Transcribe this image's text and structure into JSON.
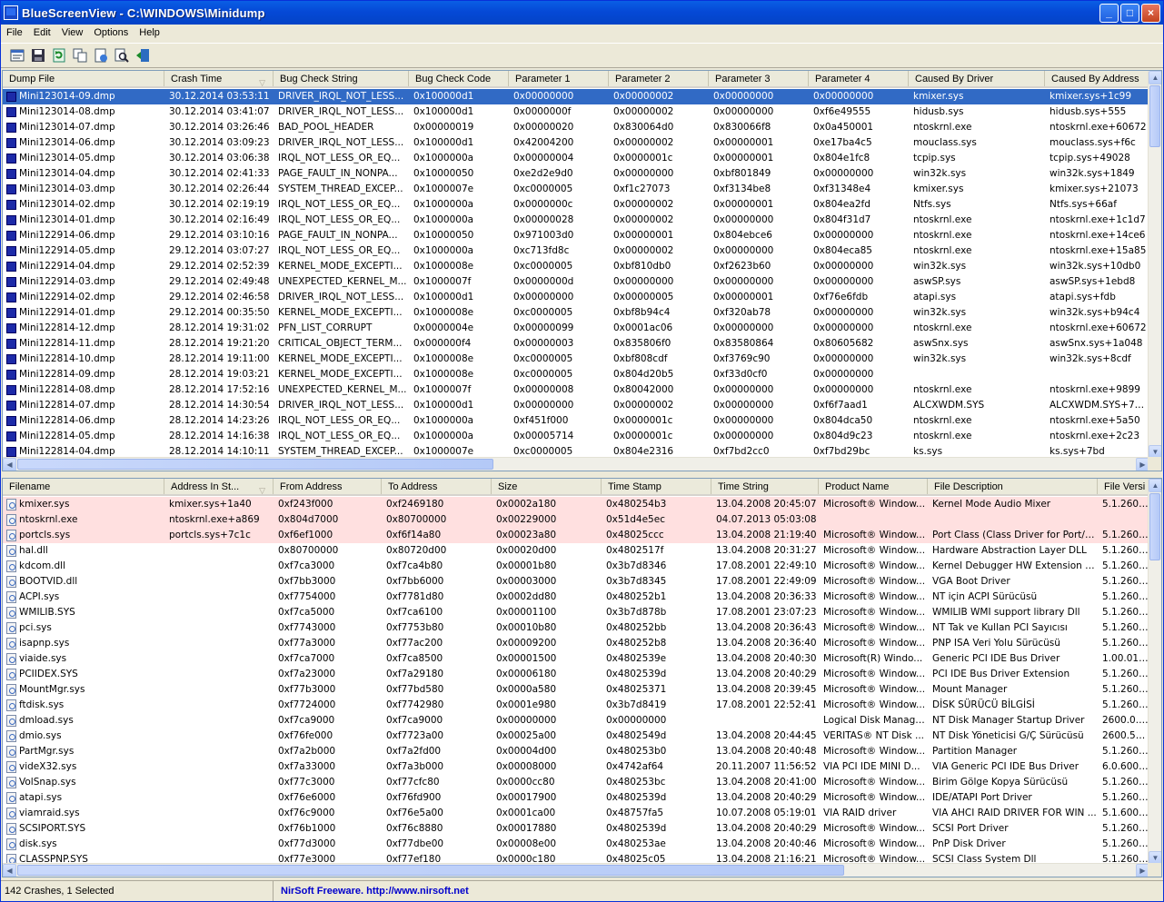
{
  "window": {
    "title": "BlueScreenView  -  C:\\WINDOWS\\Minidump",
    "minimize": "_",
    "maximize": "□",
    "close": "×"
  },
  "menu": [
    "File",
    "Edit",
    "View",
    "Options",
    "Help"
  ],
  "toolbar": [
    "properties-icon",
    "save-icon",
    "refresh-icon",
    "copy-icon",
    "html-report-icon",
    "find-icon",
    "exit-icon"
  ],
  "top_table": {
    "columns": [
      "Dump File",
      "Crash Time",
      "Bug Check String",
      "Bug Check Code",
      "Parameter 1",
      "Parameter 2",
      "Parameter 3",
      "Parameter 4",
      "Caused By Driver",
      "Caused By Address"
    ],
    "rows": [
      [
        "Mini123014-09.dmp",
        "30.12.2014 03:53:11",
        "DRIVER_IRQL_NOT_LESS...",
        "0x100000d1",
        "0x00000000",
        "0x00000002",
        "0x00000000",
        "0x00000000",
        "kmixer.sys",
        "kmixer.sys+1c99"
      ],
      [
        "Mini123014-08.dmp",
        "30.12.2014 03:41:07",
        "DRIVER_IRQL_NOT_LESS...",
        "0x100000d1",
        "0x0000000f",
        "0x00000002",
        "0x00000000",
        "0xf6e49555",
        "hidusb.sys",
        "hidusb.sys+555"
      ],
      [
        "Mini123014-07.dmp",
        "30.12.2014 03:26:46",
        "BAD_POOL_HEADER",
        "0x00000019",
        "0x00000020",
        "0x830064d0",
        "0x830066f8",
        "0x0a450001",
        "ntoskrnl.exe",
        "ntoskrnl.exe+60672"
      ],
      [
        "Mini123014-06.dmp",
        "30.12.2014 03:09:23",
        "DRIVER_IRQL_NOT_LESS...",
        "0x100000d1",
        "0x42004200",
        "0x00000002",
        "0x00000001",
        "0xe17ba4c5",
        "mouclass.sys",
        "mouclass.sys+f6c"
      ],
      [
        "Mini123014-05.dmp",
        "30.12.2014 03:06:38",
        "IRQL_NOT_LESS_OR_EQ...",
        "0x1000000a",
        "0x00000004",
        "0x0000001c",
        "0x00000001",
        "0x804e1fc8",
        "tcpip.sys",
        "tcpip.sys+49028"
      ],
      [
        "Mini123014-04.dmp",
        "30.12.2014 02:41:33",
        "PAGE_FAULT_IN_NONPA...",
        "0x10000050",
        "0xe2d2e9d0",
        "0x00000000",
        "0xbf801849",
        "0x00000000",
        "win32k.sys",
        "win32k.sys+1849"
      ],
      [
        "Mini123014-03.dmp",
        "30.12.2014 02:26:44",
        "SYSTEM_THREAD_EXCEP...",
        "0x1000007e",
        "0xc0000005",
        "0xf1c27073",
        "0xf3134be8",
        "0xf31348e4",
        "kmixer.sys",
        "kmixer.sys+21073"
      ],
      [
        "Mini123014-02.dmp",
        "30.12.2014 02:19:19",
        "IRQL_NOT_LESS_OR_EQ...",
        "0x1000000a",
        "0x0000000c",
        "0x00000002",
        "0x00000001",
        "0x804ea2fd",
        "Ntfs.sys",
        "Ntfs.sys+66af"
      ],
      [
        "Mini123014-01.dmp",
        "30.12.2014 02:16:49",
        "IRQL_NOT_LESS_OR_EQ...",
        "0x1000000a",
        "0x00000028",
        "0x00000002",
        "0x00000000",
        "0x804f31d7",
        "ntoskrnl.exe",
        "ntoskrnl.exe+1c1d7"
      ],
      [
        "Mini122914-06.dmp",
        "29.12.2014 03:10:16",
        "PAGE_FAULT_IN_NONPA...",
        "0x10000050",
        "0x971003d0",
        "0x00000001",
        "0x804ebce6",
        "0x00000000",
        "ntoskrnl.exe",
        "ntoskrnl.exe+14ce6"
      ],
      [
        "Mini122914-05.dmp",
        "29.12.2014 03:07:27",
        "IRQL_NOT_LESS_OR_EQ...",
        "0x1000000a",
        "0xc713fd8c",
        "0x00000002",
        "0x00000000",
        "0x804eca85",
        "ntoskrnl.exe",
        "ntoskrnl.exe+15a85"
      ],
      [
        "Mini122914-04.dmp",
        "29.12.2014 02:52:39",
        "KERNEL_MODE_EXCEPTI...",
        "0x1000008e",
        "0xc0000005",
        "0xbf810db0",
        "0xf2623b60",
        "0x00000000",
        "win32k.sys",
        "win32k.sys+10db0"
      ],
      [
        "Mini122914-03.dmp",
        "29.12.2014 02:49:48",
        "UNEXPECTED_KERNEL_M...",
        "0x1000007f",
        "0x0000000d",
        "0x00000000",
        "0x00000000",
        "0x00000000",
        "aswSP.sys",
        "aswSP.sys+1ebd8"
      ],
      [
        "Mini122914-02.dmp",
        "29.12.2014 02:46:58",
        "DRIVER_IRQL_NOT_LESS...",
        "0x100000d1",
        "0x00000000",
        "0x00000005",
        "0x00000001",
        "0xf76e6fdb",
        "atapi.sys",
        "atapi.sys+fdb"
      ],
      [
        "Mini122914-01.dmp",
        "29.12.2014 00:35:50",
        "KERNEL_MODE_EXCEPTI...",
        "0x1000008e",
        "0xc0000005",
        "0xbf8b94c4",
        "0xf320ab78",
        "0x00000000",
        "win32k.sys",
        "win32k.sys+b94c4"
      ],
      [
        "Mini122814-12.dmp",
        "28.12.2014 19:31:02",
        "PFN_LIST_CORRUPT",
        "0x0000004e",
        "0x00000099",
        "0x0001ac06",
        "0x00000000",
        "0x00000000",
        "ntoskrnl.exe",
        "ntoskrnl.exe+60672"
      ],
      [
        "Mini122814-11.dmp",
        "28.12.2014 19:21:20",
        "CRITICAL_OBJECT_TERM...",
        "0x000000f4",
        "0x00000003",
        "0x835806f0",
        "0x83580864",
        "0x80605682",
        "aswSnx.sys",
        "aswSnx.sys+1a048"
      ],
      [
        "Mini122814-10.dmp",
        "28.12.2014 19:11:00",
        "KERNEL_MODE_EXCEPTI...",
        "0x1000008e",
        "0xc0000005",
        "0xbf808cdf",
        "0xf3769c90",
        "0x00000000",
        "win32k.sys",
        "win32k.sys+8cdf"
      ],
      [
        "Mini122814-09.dmp",
        "28.12.2014 19:03:21",
        "KERNEL_MODE_EXCEPTI...",
        "0x1000008e",
        "0xc0000005",
        "0x804d20b5",
        "0xf33d0cf0",
        "0x00000000",
        "",
        ""
      ],
      [
        "Mini122814-08.dmp",
        "28.12.2014 17:52:16",
        "UNEXPECTED_KERNEL_M...",
        "0x1000007f",
        "0x00000008",
        "0x80042000",
        "0x00000000",
        "0x00000000",
        "ntoskrnl.exe",
        "ntoskrnl.exe+9899"
      ],
      [
        "Mini122814-07.dmp",
        "28.12.2014 14:30:54",
        "DRIVER_IRQL_NOT_LESS...",
        "0x100000d1",
        "0x00000000",
        "0x00000002",
        "0x00000000",
        "0xf6f7aad1",
        "ALCXWDM.SYS",
        "ALCXWDM.SYS+79..."
      ],
      [
        "Mini122814-06.dmp",
        "28.12.2014 14:23:26",
        "IRQL_NOT_LESS_OR_EQ...",
        "0x1000000a",
        "0xf451f000",
        "0x0000001c",
        "0x00000000",
        "0x804dca50",
        "ntoskrnl.exe",
        "ntoskrnl.exe+5a50"
      ],
      [
        "Mini122814-05.dmp",
        "28.12.2014 14:16:38",
        "IRQL_NOT_LESS_OR_EQ...",
        "0x1000000a",
        "0x00005714",
        "0x0000001c",
        "0x00000000",
        "0x804d9c23",
        "ntoskrnl.exe",
        "ntoskrnl.exe+2c23"
      ],
      [
        "Mini122814-04.dmp",
        "28.12.2014 14:10:11",
        "SYSTEM_THREAD_EXCEP...",
        "0x1000007e",
        "0xc0000005",
        "0x804e2316",
        "0xf7bd2cc0",
        "0xf7bd29bc",
        "ks.sys",
        "ks.sys+7bd"
      ]
    ]
  },
  "bottom_table": {
    "columns": [
      "Filename",
      "Address In St...",
      "From Address",
      "To Address",
      "Size",
      "Time Stamp",
      "Time String",
      "Product Name",
      "File Description",
      "File Versi"
    ],
    "rows": [
      [
        "kmixer.sys",
        "kmixer.sys+1a40",
        "0xf243f000",
        "0xf2469180",
        "0x0002a180",
        "0x480254b3",
        "13.04.2008 20:45:07",
        "Microsoft® Window...",
        "Kernel Mode Audio Mixer",
        "5.1.2600..."
      ],
      [
        "ntoskrnl.exe",
        "ntoskrnl.exe+a869",
        "0x804d7000",
        "0x80700000",
        "0x00229000",
        "0x51d4e5ec",
        "04.07.2013 05:03:08",
        "",
        "",
        ""
      ],
      [
        "portcls.sys",
        "portcls.sys+7c1c",
        "0xf6ef1000",
        "0xf6f14a80",
        "0x00023a80",
        "0x48025ccc",
        "13.04.2008 21:19:40",
        "Microsoft® Window...",
        "Port Class (Class Driver for Port/M...",
        "5.1.2600..."
      ],
      [
        "hal.dll",
        "",
        "0x80700000",
        "0x80720d00",
        "0x00020d00",
        "0x4802517f",
        "13.04.2008 20:31:27",
        "Microsoft® Window...",
        "Hardware Abstraction Layer DLL",
        "5.1.2600..."
      ],
      [
        "kdcom.dll",
        "",
        "0xf7ca3000",
        "0xf7ca4b80",
        "0x00001b80",
        "0x3b7d8346",
        "17.08.2001 22:49:10",
        "Microsoft® Window...",
        "Kernel Debugger HW Extension DLL",
        "5.1.2600..."
      ],
      [
        "BOOTVID.dll",
        "",
        "0xf7bb3000",
        "0xf7bb6000",
        "0x00003000",
        "0x3b7d8345",
        "17.08.2001 22:49:09",
        "Microsoft® Window...",
        "VGA Boot Driver",
        "5.1.2600..."
      ],
      [
        "ACPI.sys",
        "",
        "0xf7754000",
        "0xf7781d80",
        "0x0002dd80",
        "0x480252b1",
        "13.04.2008 20:36:33",
        "Microsoft® Window...",
        "NT için ACPI Sürücüsü",
        "5.1.2600..."
      ],
      [
        "WMILIB.SYS",
        "",
        "0xf7ca5000",
        "0xf7ca6100",
        "0x00001100",
        "0x3b7d878b",
        "17.08.2001 23:07:23",
        "Microsoft® Window...",
        "WMILIB WMI support library Dll",
        "5.1.2600..."
      ],
      [
        "pci.sys",
        "",
        "0xf7743000",
        "0xf7753b80",
        "0x00010b80",
        "0x480252bb",
        "13.04.2008 20:36:43",
        "Microsoft® Window...",
        "NT Tak ve Kullan PCI Sayıcısı",
        "5.1.2600..."
      ],
      [
        "isapnp.sys",
        "",
        "0xf77a3000",
        "0xf77ac200",
        "0x00009200",
        "0x480252b8",
        "13.04.2008 20:36:40",
        "Microsoft® Window...",
        "PNP ISA Veri Yolu Sürücüsü",
        "5.1.2600..."
      ],
      [
        "viaide.sys",
        "",
        "0xf7ca7000",
        "0xf7ca8500",
        "0x00001500",
        "0x4802539e",
        "13.04.2008 20:40:30",
        "Microsoft(R) Windo...",
        "Generic PCI IDE Bus Driver",
        "1.00.01.0..."
      ],
      [
        "PCIIDEX.SYS",
        "",
        "0xf7a23000",
        "0xf7a29180",
        "0x00006180",
        "0x4802539d",
        "13.04.2008 20:40:29",
        "Microsoft® Window...",
        "PCI IDE Bus Driver Extension",
        "5.1.2600..."
      ],
      [
        "MountMgr.sys",
        "",
        "0xf77b3000",
        "0xf77bd580",
        "0x0000a580",
        "0x48025371",
        "13.04.2008 20:39:45",
        "Microsoft® Window...",
        "Mount Manager",
        "5.1.2600..."
      ],
      [
        "ftdisk.sys",
        "",
        "0xf7724000",
        "0xf7742980",
        "0x0001e980",
        "0x3b7d8419",
        "17.08.2001 22:52:41",
        "Microsoft® Window...",
        "DİSK SÜRÜCÜ BİLGİSİ",
        "5.1.2600..."
      ],
      [
        "dmload.sys",
        "",
        "0xf7ca9000",
        "0xf7ca9000",
        "0x00000000",
        "0x00000000",
        "",
        "Logical Disk Manage...",
        "NT Disk Manager Startup Driver",
        "2600.0.5..."
      ],
      [
        "dmio.sys",
        "",
        "0xf76fe000",
        "0xf7723a00",
        "0x00025a00",
        "0x4802549d",
        "13.04.2008 20:44:45",
        "VERITAS® NT Disk ...",
        "NT Disk Yöneticisi G/Ç Sürücüsü",
        "2600.551..."
      ],
      [
        "PartMgr.sys",
        "",
        "0xf7a2b000",
        "0xf7a2fd00",
        "0x00004d00",
        "0x480253b0",
        "13.04.2008 20:40:48",
        "Microsoft® Window...",
        "Partition Manager",
        "5.1.2600..."
      ],
      [
        "videX32.sys",
        "",
        "0xf7a33000",
        "0xf7a3b000",
        "0x00008000",
        "0x4742af64",
        "20.11.2007 11:56:52",
        "VIA PCI IDE MINI D...",
        "VIA Generic PCI IDE Bus Driver",
        "6.0.6000..."
      ],
      [
        "VolSnap.sys",
        "",
        "0xf77c3000",
        "0xf77cfc80",
        "0x0000cc80",
        "0x480253bc",
        "13.04.2008 20:41:00",
        "Microsoft® Window...",
        "Birim Gölge Kopya Sürücüsü",
        "5.1.2600..."
      ],
      [
        "atapi.sys",
        "",
        "0xf76e6000",
        "0xf76fd900",
        "0x00017900",
        "0x4802539d",
        "13.04.2008 20:40:29",
        "Microsoft® Window...",
        "IDE/ATAPI Port Driver",
        "5.1.2600..."
      ],
      [
        "viamraid.sys",
        "",
        "0xf76c9000",
        "0xf76e5a00",
        "0x0001ca00",
        "0x48757fa5",
        "10.07.2008 05:19:01",
        "VIA RAID driver",
        "VIA AHCI RAID DRIVER FOR WIN ...",
        "5.1.6000..."
      ],
      [
        "SCSIPORT.SYS",
        "",
        "0xf76b1000",
        "0xf76c8880",
        "0x00017880",
        "0x4802539d",
        "13.04.2008 20:40:29",
        "Microsoft® Window...",
        "SCSI Port Driver",
        "5.1.2600..."
      ],
      [
        "disk.sys",
        "",
        "0xf77d3000",
        "0xf77dbe00",
        "0x00008e00",
        "0x480253ae",
        "13.04.2008 20:40:46",
        "Microsoft® Window...",
        "PnP Disk Driver",
        "5.1.2600..."
      ],
      [
        "CLASSPNP.SYS",
        "",
        "0xf77e3000",
        "0xf77ef180",
        "0x0000c180",
        "0x48025c05",
        "13.04.2008 21:16:21",
        "Microsoft® Window...",
        "SCSI Class System Dll",
        "5.1.2600..."
      ]
    ]
  },
  "status": {
    "count": "142 Crashes, 1 Selected",
    "link": "NirSoft Freeware.  http://www.nirsoft.net"
  }
}
